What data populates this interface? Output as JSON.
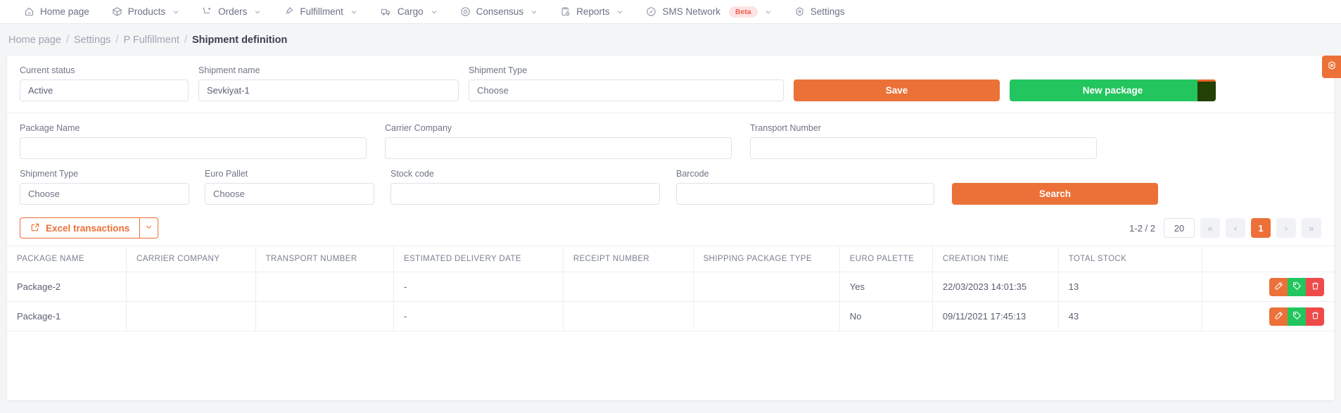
{
  "nav": {
    "items": [
      {
        "label": "Home page",
        "icon": "home-icon",
        "caret": false
      },
      {
        "label": "Products",
        "icon": "box-icon",
        "caret": true
      },
      {
        "label": "Orders",
        "icon": "cart-plus-icon",
        "caret": true
      },
      {
        "label": "Fulfillment",
        "icon": "pin-icon",
        "caret": true
      },
      {
        "label": "Cargo",
        "icon": "truck-icon",
        "caret": true
      },
      {
        "label": "Consensus",
        "icon": "target-icon",
        "caret": true
      },
      {
        "label": "Reports",
        "icon": "clipboard-clock-icon",
        "caret": true
      },
      {
        "label": "SMS Network",
        "icon": "check-circle-icon",
        "caret": true,
        "badge": "Beta"
      },
      {
        "label": "Settings",
        "icon": "gear-icon",
        "caret": false
      }
    ]
  },
  "breadcrumb": {
    "items": [
      "Home page",
      "Settings",
      "P Fulfillment",
      "Shipment definition"
    ],
    "separator": "/"
  },
  "form": {
    "current_status": {
      "label": "Current status",
      "value": "Active"
    },
    "shipment_name": {
      "label": "Shipment name",
      "value": "Sevkiyat-1"
    },
    "shipment_type": {
      "label": "Shipment Type",
      "value": "Choose"
    },
    "save_button": "Save",
    "new_package_button": "New package",
    "package_name": {
      "label": "Package Name",
      "value": ""
    },
    "carrier_company": {
      "label": "Carrier Company",
      "value": ""
    },
    "transport_number": {
      "label": "Transport Number",
      "value": ""
    },
    "filter_shipment_type": {
      "label": "Shipment Type",
      "value": "Choose"
    },
    "euro_pallet": {
      "label": "Euro Pallet",
      "value": "Choose"
    },
    "stock_code": {
      "label": "Stock code",
      "value": ""
    },
    "barcode": {
      "label": "Barcode",
      "value": ""
    },
    "search_button": "Search"
  },
  "toolbar": {
    "excel_label": "Excel transactions",
    "excel_icon": "external-link-icon",
    "caret_icon": "chevron-down-icon"
  },
  "pagination": {
    "range_text": "1-2 / 2",
    "page_size": "20",
    "first": "«",
    "prev": "‹",
    "current_page": "1",
    "next": "›",
    "last": "»"
  },
  "table": {
    "columns": [
      "PACKAGE NAME",
      "CARRIER COMPANY",
      "TRANSPORT NUMBER",
      "ESTIMATED DELIVERY DATE",
      "RECEIPT NUMBER",
      "SHIPPING PACKAGE TYPE",
      "EURO PALETTE",
      "CREATION TIME",
      "TOTAL STOCK",
      ""
    ],
    "rows": [
      {
        "package_name": "Package-2",
        "carrier_company": "",
        "transport_number": "",
        "estimated_delivery_date": "-",
        "receipt_number": "",
        "shipping_package_type": "",
        "euro_palette": "Yes",
        "creation_time": "22/03/2023 14:01:35",
        "total_stock": "13"
      },
      {
        "package_name": "Package-1",
        "carrier_company": "",
        "transport_number": "",
        "estimated_delivery_date": "-",
        "receipt_number": "",
        "shipping_package_type": "",
        "euro_palette": "No",
        "creation_time": "09/11/2021 17:45:13",
        "total_stock": "43"
      }
    ],
    "actions": {
      "edit_icon": "pencil-edit-icon",
      "tag_icon": "tag-icon",
      "delete_icon": "trash-icon"
    }
  },
  "floating": {
    "gear_icon": "gear-icon"
  },
  "colors": {
    "primary_orange": "#ec7138",
    "green": "#22c55e",
    "red": "#ef4a4a",
    "beta_badge_bg": "#fde4e4",
    "beta_badge_text": "#f4604f"
  }
}
